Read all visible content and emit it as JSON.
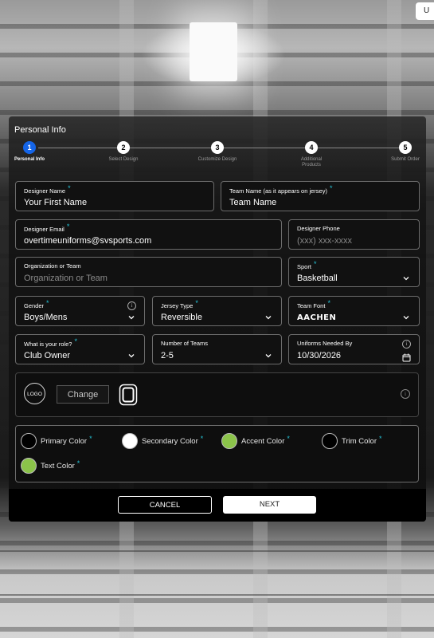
{
  "top_tab": "U",
  "panel_title": "Personal Info",
  "steps": [
    {
      "num": "1",
      "label": "Personal Info",
      "active": true
    },
    {
      "num": "2",
      "label": "Select Design",
      "active": false
    },
    {
      "num": "3",
      "label": "Customize Design",
      "active": false
    },
    {
      "num": "4",
      "label": "Additional Products",
      "active": false
    },
    {
      "num": "5",
      "label": "Submit Order",
      "active": false
    }
  ],
  "fields": {
    "designer_name": {
      "label": "Designer Name",
      "value": "Your First Name"
    },
    "team_name": {
      "label": "Team Name (as it appears on jersey)",
      "value": "Team Name"
    },
    "designer_email": {
      "label": "Designer Email",
      "value": "overtimeuniforms@svsports.com"
    },
    "designer_phone": {
      "label": "Designer Phone",
      "placeholder": "(xxx) xxx-xxxx"
    },
    "organization": {
      "label": "Organization or Team",
      "placeholder": "Organization or Team"
    },
    "sport": {
      "label": "Sport",
      "value": "Basketball"
    },
    "gender": {
      "label": "Gender",
      "value": "Boys/Mens"
    },
    "jersey_type": {
      "label": "Jersey Type",
      "value": "Reversible"
    },
    "team_font": {
      "label": "Team Font",
      "value": "AACHEN"
    },
    "role": {
      "label": "What is your role?",
      "value": "Club Owner"
    },
    "num_teams": {
      "label": "Number of Teams",
      "value": "2-5"
    },
    "needed_by": {
      "label": "Uniforms Needed By",
      "value": "10/30/2026"
    }
  },
  "logo": {
    "circle_label": "LOGO",
    "change_label": "Change"
  },
  "colors": [
    {
      "name": "Primary Color",
      "hex": "#000000"
    },
    {
      "name": "Secondary Color",
      "hex": "#ffffff"
    },
    {
      "name": "Accent Color",
      "hex": "#8bc34a"
    },
    {
      "name": "Trim Color",
      "hex": "#000000"
    },
    {
      "name": "Text Color",
      "hex": "#8bc34a"
    }
  ],
  "buttons": {
    "cancel": "CANCEL",
    "next": "NEXT"
  },
  "required_mark": "*",
  "info_mark": "i"
}
